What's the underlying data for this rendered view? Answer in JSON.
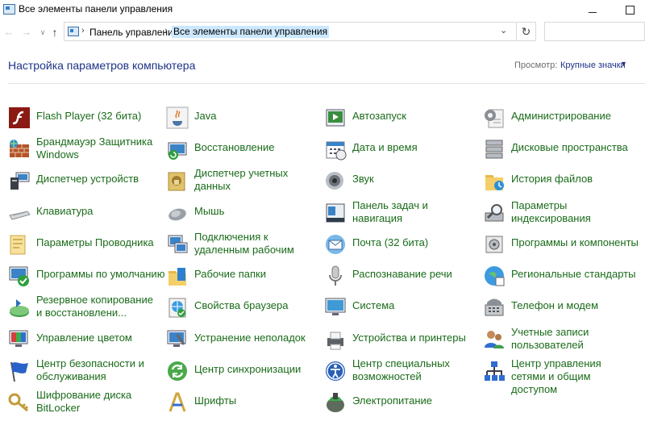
{
  "window": {
    "title": "Все элементы панели управления"
  },
  "address": {
    "crumbs": [
      "Панель управления",
      "Все элементы панели управления"
    ]
  },
  "header": {
    "heading": "Настройка параметров компьютера",
    "view_label": "Просмотр:",
    "view_value": "Крупные значки"
  },
  "items": [
    {
      "label": "Flash Player (32 бита)",
      "icon": "flash-icon"
    },
    {
      "label": "Брандмауэр Защитника Windows",
      "icon": "firewall-icon"
    },
    {
      "label": "Диспетчер устройств",
      "icon": "device-manager-icon"
    },
    {
      "label": "Клавиатура",
      "icon": "keyboard-icon"
    },
    {
      "label": "Параметры Проводника",
      "icon": "folder-options-icon"
    },
    {
      "label": "Программы по умолчанию",
      "icon": "default-programs-icon"
    },
    {
      "label": "Резервное копирование и восстановлени...",
      "icon": "backup-icon"
    },
    {
      "label": "Управление цветом",
      "icon": "color-management-icon"
    },
    {
      "label": "Центр безопасности и обслуживания",
      "icon": "security-flag-icon"
    },
    {
      "label": "Шифрование диска BitLocker",
      "icon": "bitlocker-key-icon"
    },
    {
      "label": "Java",
      "icon": "java-icon"
    },
    {
      "label": "Восстановление",
      "icon": "recovery-icon"
    },
    {
      "label": "Диспетчер учетных данных",
      "icon": "credential-manager-icon"
    },
    {
      "label": "Мышь",
      "icon": "mouse-icon"
    },
    {
      "label": "Подключения к удаленным рабочим",
      "icon": "remote-desktop-icon"
    },
    {
      "label": "Рабочие папки",
      "icon": "work-folders-icon"
    },
    {
      "label": "Свойства браузера",
      "icon": "internet-options-icon"
    },
    {
      "label": "Устранение неполадок",
      "icon": "troubleshooting-icon"
    },
    {
      "label": "Центр синхронизации",
      "icon": "sync-center-icon"
    },
    {
      "label": "Шрифты",
      "icon": "fonts-icon"
    },
    {
      "label": "Автозапуск",
      "icon": "autoplay-icon"
    },
    {
      "label": "Дата и время",
      "icon": "date-time-icon"
    },
    {
      "label": "Звук",
      "icon": "sound-icon"
    },
    {
      "label": "Панель задач и навигация",
      "icon": "taskbar-icon"
    },
    {
      "label": "Почта (32 бита)",
      "icon": "mail-icon"
    },
    {
      "label": "Распознавание речи",
      "icon": "microphone-icon"
    },
    {
      "label": "Система",
      "icon": "system-icon"
    },
    {
      "label": "Устройства и принтеры",
      "icon": "devices-printers-icon"
    },
    {
      "label": "Центр специальных возможностей",
      "icon": "ease-of-access-icon"
    },
    {
      "label": "Электропитание",
      "icon": "power-options-icon"
    },
    {
      "label": "Администрирование",
      "icon": "admin-tools-icon"
    },
    {
      "label": "Дисковые пространства",
      "icon": "storage-spaces-icon"
    },
    {
      "label": "История файлов",
      "icon": "file-history-icon"
    },
    {
      "label": "Параметры индексирования",
      "icon": "indexing-icon"
    },
    {
      "label": "Программы и компоненты",
      "icon": "programs-features-icon"
    },
    {
      "label": "Региональные стандарты",
      "icon": "region-icon"
    },
    {
      "label": "Телефон и модем",
      "icon": "phone-modem-icon"
    },
    {
      "label": "Учетные записи пользователей",
      "icon": "user-accounts-icon"
    },
    {
      "label": "Центр управления сетями и общим доступом",
      "icon": "network-center-icon"
    }
  ]
}
